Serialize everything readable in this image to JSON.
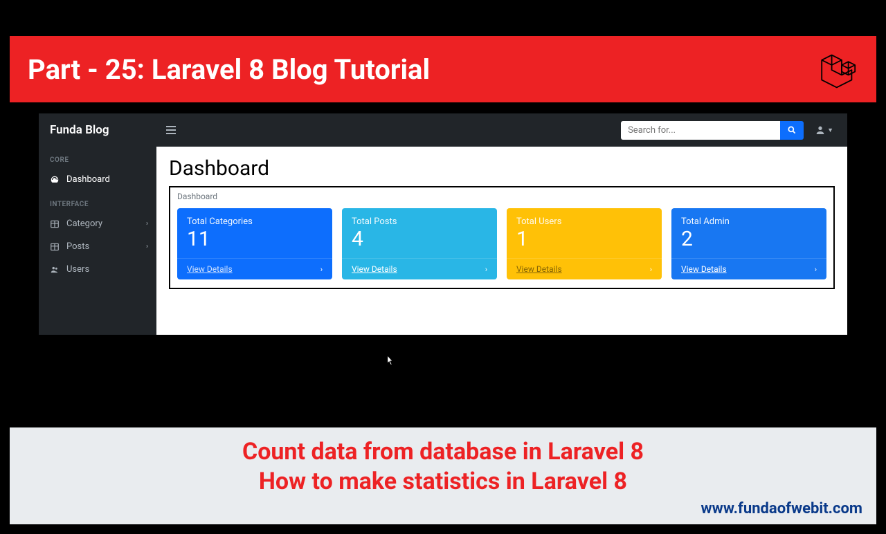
{
  "banner": {
    "title": "Part - 25: Laravel 8 Blog Tutorial"
  },
  "sidebar": {
    "brand": "Funda Blog",
    "section_core": "CORE",
    "section_interface": "INTERFACE",
    "items": {
      "dashboard": "Dashboard",
      "category": "Category",
      "posts": "Posts",
      "users": "Users"
    }
  },
  "topnav": {
    "search_placeholder": "Search for..."
  },
  "page": {
    "title": "Dashboard",
    "breadcrumb": "Dashboard"
  },
  "cards": [
    {
      "label": "Total Categories",
      "value": "11",
      "link": "View Details"
    },
    {
      "label": "Total Posts",
      "value": "4",
      "link": "View Details"
    },
    {
      "label": "Total Users",
      "value": "1",
      "link": "View Details"
    },
    {
      "label": "Total Admin",
      "value": "2",
      "link": "View Details"
    }
  ],
  "bottom": {
    "line1": "Count data from database in Laravel 8",
    "line2": "How to make statistics in Laravel 8",
    "url": "www.fundaofwebit.com"
  }
}
